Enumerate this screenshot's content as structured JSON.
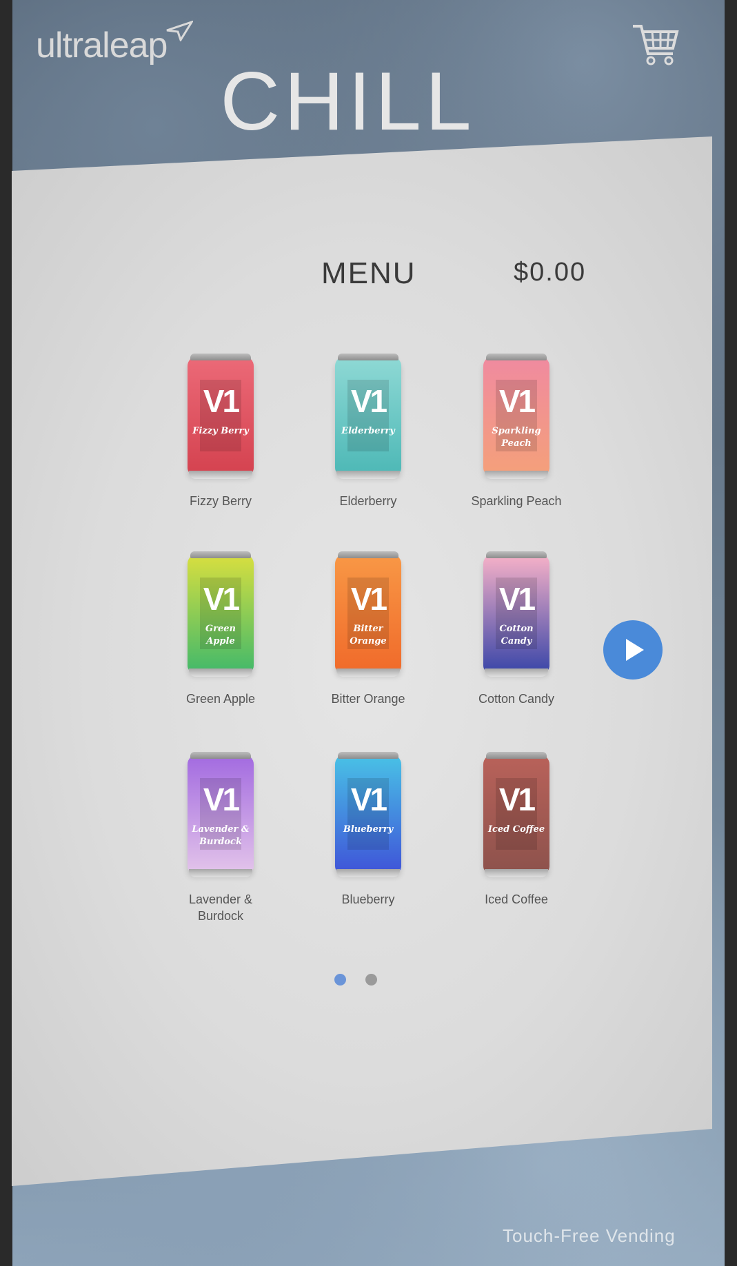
{
  "brand": {
    "logo_text": "ultraleap"
  },
  "header": {
    "title": "CHILL"
  },
  "menu": {
    "title": "MENU",
    "price": "$0.00"
  },
  "products": [
    {
      "name": "Fizzy Berry",
      "can_text": "Fizzy Berry",
      "badge": "V1",
      "gradient": [
        "#ec6a78",
        "#d4424f"
      ]
    },
    {
      "name": "Elderberry",
      "can_text": "Elderberry",
      "badge": "V1",
      "gradient": [
        "#8fd9d5",
        "#4db8b6"
      ]
    },
    {
      "name": "Sparkling Peach",
      "can_text": "Sparkling Peach",
      "badge": "V1",
      "gradient": [
        "#f08aa0",
        "#f4a07a"
      ]
    },
    {
      "name": "Green Apple",
      "can_text": "Green Apple",
      "badge": "V1",
      "gradient": [
        "#d9df3f",
        "#42b96a"
      ]
    },
    {
      "name": "Bitter Orange",
      "can_text": "Bitter Orange",
      "badge": "V1",
      "gradient": [
        "#f89846",
        "#f06a2a"
      ]
    },
    {
      "name": "Cotton Candy",
      "can_text": "Cotton Candy",
      "badge": "V1",
      "gradient": [
        "#f8b2c8",
        "#3a46a8"
      ]
    },
    {
      "name": "Lavender & Burdock",
      "can_text": "Lavender & Burdock",
      "badge": "V1",
      "gradient": [
        "#a26ae0",
        "#e3c4ea"
      ]
    },
    {
      "name": "Blueberry",
      "can_text": "Blueberry",
      "badge": "V1",
      "gradient": [
        "#49c2e6",
        "#3f54d8"
      ]
    },
    {
      "name": "Iced Coffee",
      "can_text": "Iced Coffee",
      "badge": "V1",
      "gradient": [
        "#b9625a",
        "#8d524c"
      ]
    }
  ],
  "pagination": {
    "pages": 2,
    "current": 1,
    "active_color": "#6a94d8",
    "inactive_color": "#9a9a9a"
  },
  "footer": {
    "tagline": "Touch-Free Vending"
  },
  "colors": {
    "accent": "#4a8ad9"
  }
}
